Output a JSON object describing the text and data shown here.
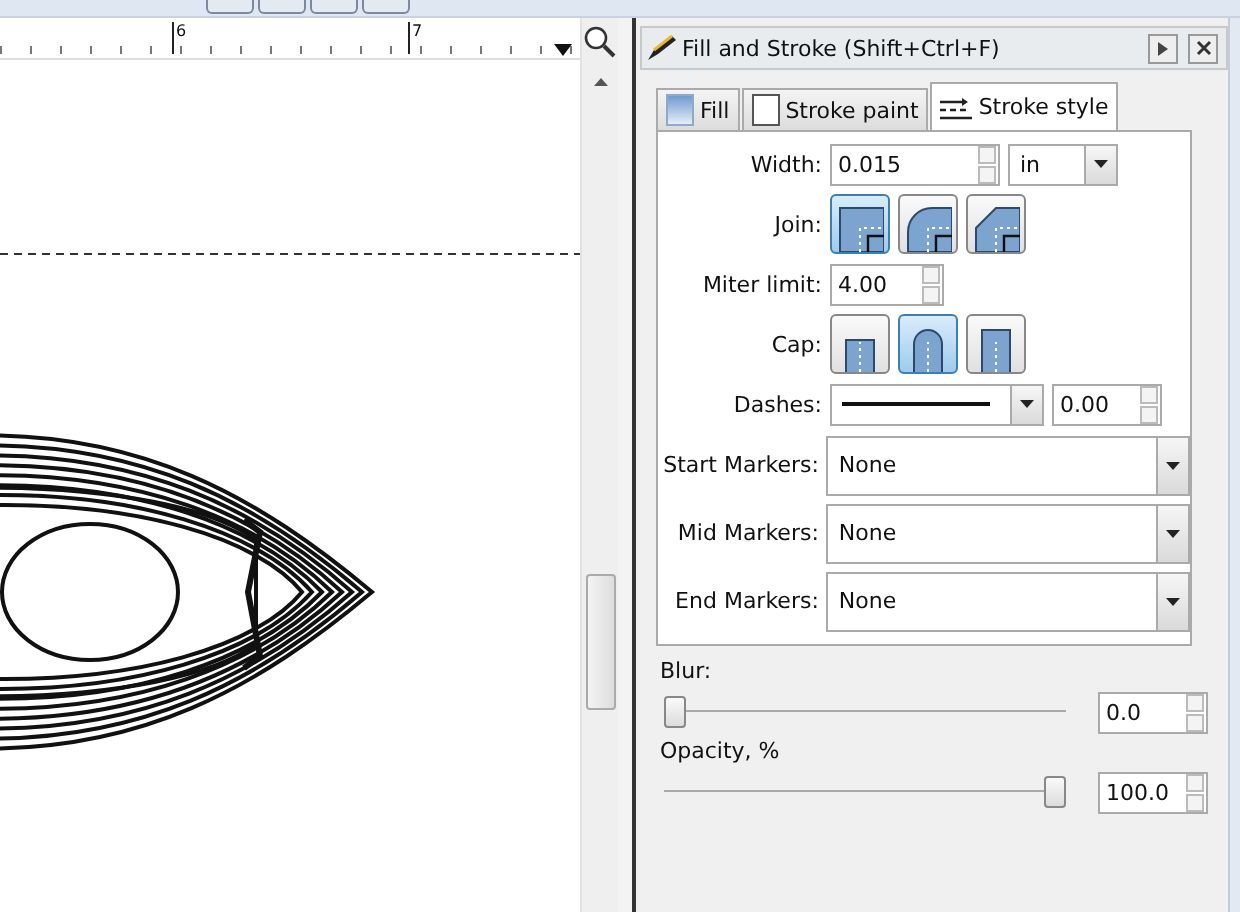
{
  "ruler": {
    "labels": [
      "6",
      "7"
    ]
  },
  "dialog": {
    "title": "Fill and Stroke (Shift+Ctrl+F)",
    "tabs": [
      {
        "label": "Fill",
        "selected": false,
        "kind": "fill"
      },
      {
        "label": "Stroke paint",
        "selected": false,
        "kind": "paint"
      },
      {
        "label": "Stroke style",
        "selected": true,
        "kind": "style"
      }
    ],
    "width": {
      "label": "Width:",
      "value": "0.015",
      "unit": "in"
    },
    "join": {
      "label": "Join:",
      "options": [
        {
          "kind": "miter",
          "selected": true
        },
        {
          "kind": "round",
          "selected": false
        },
        {
          "kind": "bevel",
          "selected": false
        }
      ]
    },
    "miter_limit": {
      "label": "Miter limit:",
      "value": "4.00"
    },
    "cap": {
      "label": "Cap:",
      "options": [
        {
          "kind": "butt",
          "selected": false
        },
        {
          "kind": "round",
          "selected": true
        },
        {
          "kind": "square",
          "selected": false
        }
      ]
    },
    "dashes": {
      "label": "Dashes:",
      "value": "0.00"
    },
    "markers": [
      {
        "label": "Start Markers:",
        "value": "None"
      },
      {
        "label": "Mid Markers:",
        "value": "None"
      },
      {
        "label": "End Markers:",
        "value": "None"
      }
    ],
    "blur": {
      "label": "Blur:",
      "level": 0,
      "value": "0.0"
    },
    "opacity": {
      "label": "Opacity, %",
      "level": 1,
      "value": "100.0"
    }
  }
}
